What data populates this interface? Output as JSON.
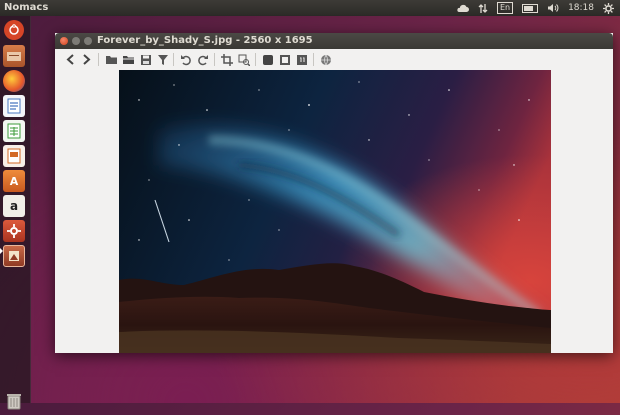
{
  "top_panel": {
    "app_name": "Nomacs",
    "lang": "En",
    "time": "18:18"
  },
  "launcher": {
    "items": [
      {
        "name": "dash-home-icon",
        "glyph": "",
        "bg": "#d64527"
      },
      {
        "name": "files-icon",
        "glyph": "",
        "bg": "#c96a3a"
      },
      {
        "name": "firefox-icon",
        "glyph": "",
        "bg": "#e6702b"
      },
      {
        "name": "writer-icon",
        "glyph": "",
        "bg": "#e9eef5"
      },
      {
        "name": "calc-icon",
        "glyph": "",
        "bg": "#e7f1e3"
      },
      {
        "name": "impress-icon",
        "glyph": "",
        "bg": "#f4e7dd"
      },
      {
        "name": "software-center-icon",
        "glyph": "A",
        "bg": "#e07a2c"
      },
      {
        "name": "amazon-icon",
        "glyph": "a",
        "bg": "#e9e6e0"
      },
      {
        "name": "system-settings-icon",
        "glyph": "",
        "bg": "#c9472f"
      },
      {
        "name": "nomacs-icon",
        "glyph": "",
        "bg": "#b0543b"
      }
    ]
  },
  "window": {
    "title": "Forever_by_Shady_S.jpg  - 2560 x 1695"
  },
  "colors": {
    "accent": "#dd4814",
    "panel": "#3c3b37",
    "window_bg": "#f2f1f0"
  }
}
